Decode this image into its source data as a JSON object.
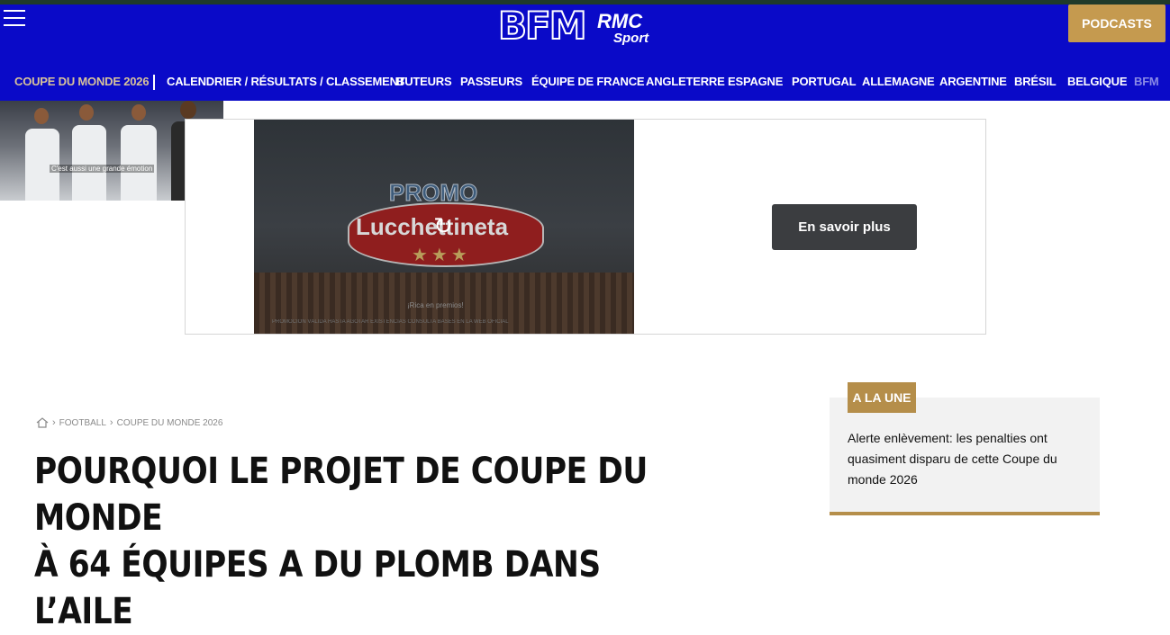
{
  "header": {
    "logo_bfm": "BFM",
    "logo_rmc": "RMC",
    "logo_sport": "Sport",
    "podcasts_label": "PODCASTS"
  },
  "nav": {
    "items": [
      {
        "label": "COUPE DU MONDE 2026"
      },
      {
        "label": "CALENDRIER / RÉSULTATS / CLASSEMENT"
      },
      {
        "label": "BUTEURS"
      },
      {
        "label": "PASSEURS"
      },
      {
        "label": "ÉQUIPE DE FRANCE"
      },
      {
        "label": "ANGLETERRE"
      },
      {
        "label": "ESPAGNE"
      },
      {
        "label": "PORTUGAL"
      },
      {
        "label": "ALLEMAGNE"
      },
      {
        "label": "ARGENTINE"
      },
      {
        "label": "BRÉSIL"
      },
      {
        "label": "BELGIQUE"
      },
      {
        "label": "BFM"
      }
    ]
  },
  "video": {
    "caption": "C'est aussi une grande émotion"
  },
  "ad": {
    "promo": "PROMO",
    "brand": "Lucchettineta",
    "stars": "★★★",
    "tag": "¡Rica en premios!",
    "disclaimer": "PROMOCIÓN VÁLIDA HASTA AGOTAR EXISTENCIAS CONSULTA BASES EN LA WEB OFICIAL",
    "cta_label": "En savoir plus"
  },
  "breadcrumb": {
    "items": [
      "FOOTBALL",
      "COUPE DU MONDE 2026"
    ]
  },
  "article": {
    "title_line1": "POURQUOI LE PROJET DE COUPE DU MONDE",
    "title_line2": "À 64 ÉQUIPES A DU PLOMB DANS L’AILE"
  },
  "sidebar": {
    "badge": "A LA UNE",
    "headline": "Alerte enlèvement: les penalties ont quasiment disparu de cette Coupe du monde 2026"
  },
  "colors": {
    "header_blue": "#0a0ac8",
    "gold": "#c59a4f",
    "cta_dark": "#3b3d40"
  }
}
